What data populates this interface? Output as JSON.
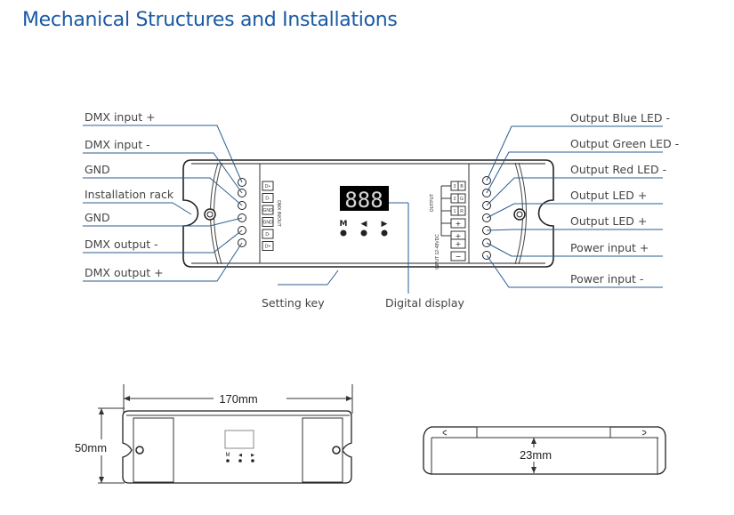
{
  "title": "Mechanical Structures and Installations",
  "left_labels": [
    "DMX input +",
    "DMX input -",
    "GND",
    "Installation rack",
    "GND",
    "DMX output -",
    "DMX output +"
  ],
  "right_labels": [
    "Output Blue LED -",
    "Output Green LED -",
    "Output Red LED -",
    "Output LED +",
    "Output LED +",
    "Power input +",
    "Power input -"
  ],
  "bottom_labels": {
    "setting_key": "Setting key",
    "digital_display": "Digital display"
  },
  "dmx_terminals": [
    "D+",
    "D-",
    "GND",
    "GND",
    "D-",
    "D+"
  ],
  "dmx_terminal_caption": "DMX IN/OUT",
  "output_terminals": [
    [
      "3",
      "B"
    ],
    [
      "2",
      "G"
    ],
    [
      "1",
      "R"
    ],
    [
      "+"
    ],
    [
      "+"
    ]
  ],
  "input_terminals": [
    "+",
    "−"
  ],
  "output_caption": "OUTPUT",
  "input_caption": "INPUT 12-48VDC",
  "display_value": "888",
  "keys": [
    "M",
    "◀",
    "▶"
  ],
  "dimensions": {
    "length": "170mm",
    "width": "50mm",
    "height": "23mm"
  },
  "colors": {
    "title": "#1a5aa6",
    "leader": "#2a5d8f"
  }
}
